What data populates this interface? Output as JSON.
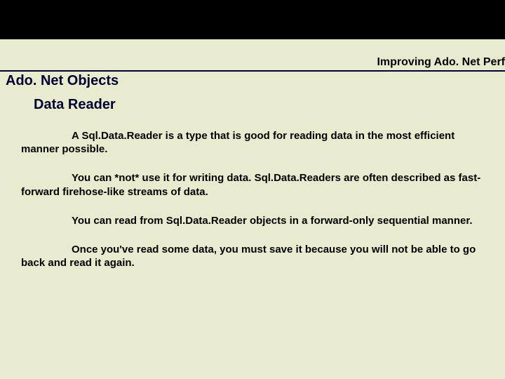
{
  "header": {
    "right_title": "Improving Ado. Net Perf"
  },
  "section": {
    "title": "Ado. Net Objects",
    "subtitle": "Data Reader"
  },
  "paragraphs": {
    "p1": "A Sql.Data.Reader is a type that is good for reading data in the most efficient manner possible.",
    "p2": "You can *not* use it for writing data.  Sql.Data.Readers are often described as fast-forward firehose-like streams of data.",
    "p3": "You can read from Sql.Data.Reader objects in a forward-only sequential manner.",
    "p4": "Once you've read some data, you must save it because you will not be able to go back and read it again."
  }
}
